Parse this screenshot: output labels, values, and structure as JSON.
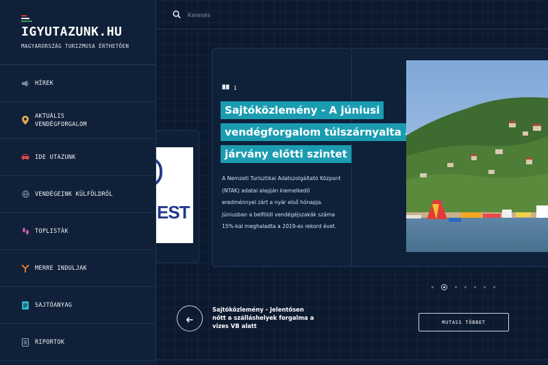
{
  "brand": {
    "title": "IGYUTAZUNK.HU",
    "subtitle": "MAGYARORSZÁG TURIZMUSA ÉRTHETŐEN",
    "flag_colors": [
      "#d9333f",
      "#ffffff",
      "#3c9a5f"
    ]
  },
  "nav": [
    {
      "label": "HÍREK",
      "icon": "megaphone-icon"
    },
    {
      "label": "AKTUÁLIS\nVENDÉGFORGALOM",
      "icon": "map-pin-icon"
    },
    {
      "label": "IDE UTAZUNK",
      "icon": "car-icon"
    },
    {
      "label": "VENDÉGEINK KÜLFÖLDRŐL",
      "icon": "globe-icon"
    },
    {
      "label": "TOPLISTÁK",
      "icon": "footprints-icon"
    },
    {
      "label": "MERRE INDULJAK",
      "icon": "signpost-icon"
    },
    {
      "label": "SAJTÓANYAG",
      "icon": "document-icon"
    },
    {
      "label": "RIPORTOK",
      "icon": "report-icon"
    }
  ],
  "search": {
    "placeholder": "Keresés"
  },
  "slide": {
    "index": "1",
    "headline": "Sajtóközlemény - A júniusi vendégforgalom túlszárnyalta a járvány előtti szintet",
    "description": "A Nemzeti Turisztikai Adatszolgáltató Központ (NTAK) adatai alapján kiemelkedő eredménnyel zárt a nyár első hónapja. Júniusban a belföldi vendégéjszakák száma 15%-kal meghaladta a 2019-es rekord évet."
  },
  "left_card": {
    "logo_text": "EST"
  },
  "pagination": {
    "count": 7,
    "active": 1
  },
  "prev_article": {
    "title": "Sajtóközlemény - Jelentősen nőtt a szálláshelyek forgalma a vizes VB alatt"
  },
  "more_button": {
    "label": "MUTASS TÖBBET"
  },
  "colors": {
    "accent": "#1b9cb1",
    "background": "#0c1a30",
    "sidebar": "#0f2038"
  }
}
